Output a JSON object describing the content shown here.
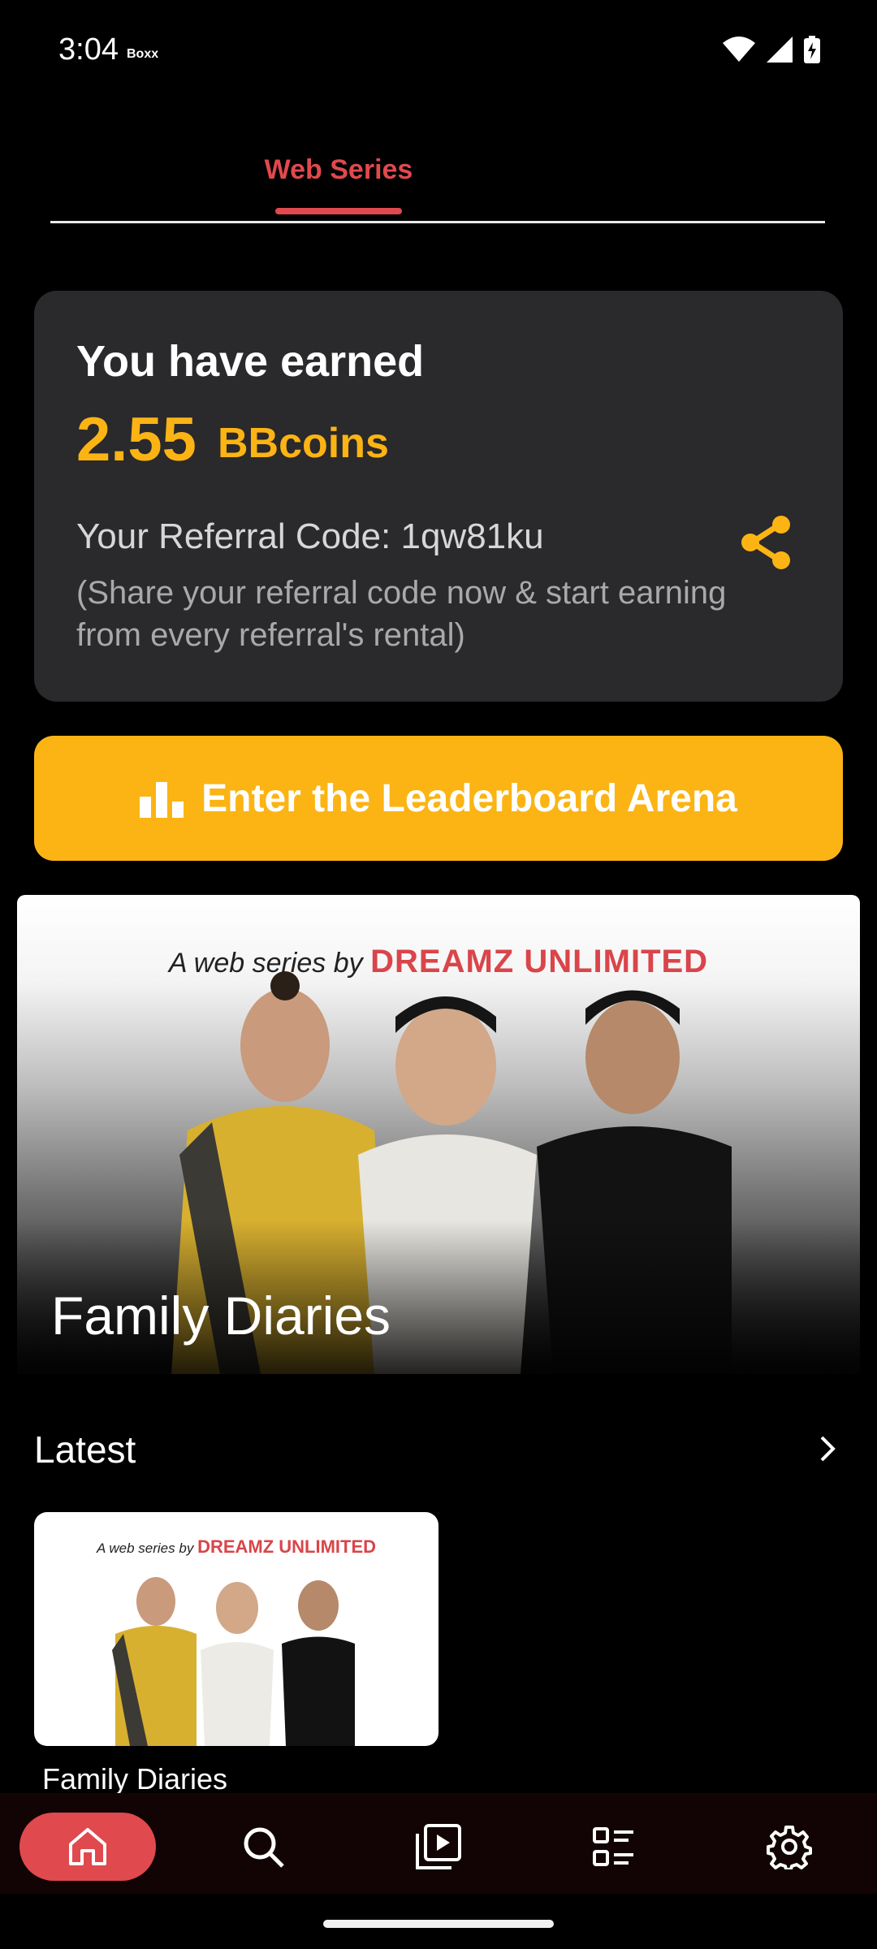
{
  "status_bar": {
    "time": "3:04",
    "carrier": "Boxx"
  },
  "tabs": [
    {
      "label": "Web Series",
      "active": true
    }
  ],
  "earnings": {
    "title": "You have earned",
    "amount": "2.55",
    "unit": "BBcoins",
    "referral_code": "Your Referral Code: 1qw81ku",
    "referral_note": "(Share your referral code now & start earning from every referral's rental)"
  },
  "leaderboard_button": {
    "label": "Enter the Leaderboard Arena"
  },
  "banner": {
    "tagline_prefix": "A web series by",
    "tagline_brand": "DREAMZ UNLIMITED",
    "title": "Family Diaries"
  },
  "latest": {
    "title": "Latest",
    "items": [
      {
        "tagline_prefix": "A web series by",
        "tagline_brand": "DREAMZ UNLIMITED",
        "title": "Family Diaries"
      }
    ]
  },
  "colors": {
    "accent": "#fbb414",
    "brand_red": "#e0494e",
    "card_bg": "#2a292b",
    "background": "#000000"
  },
  "bottom_nav": {
    "items": [
      "home-icon",
      "search-icon",
      "video-library-icon",
      "list-icon",
      "settings-icon"
    ],
    "active": "home-icon"
  }
}
